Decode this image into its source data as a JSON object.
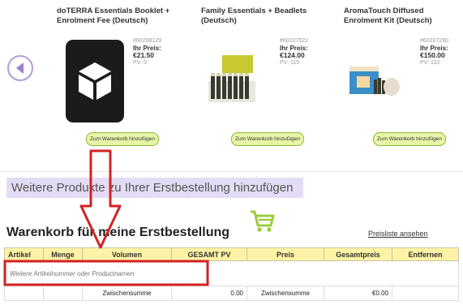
{
  "colors": {
    "accent_purple": "#9b7fd0",
    "banner_bg": "#e4dcf4",
    "table_header": "#fdf3a6",
    "add_button_bg": "#e6f5a8",
    "cart_green": "#9ccc3c",
    "annotation_red": "#d22222"
  },
  "carousel": {
    "prev_icon": "chevron-left-icon",
    "products": [
      {
        "name": "doTERRA Essentials Booklet + Enrolment Fee (Deutsch)",
        "sku": "#60208129",
        "price_label": "Ihr Preis:",
        "price": "€21.50",
        "pv": "PV: 0",
        "add_label": "Zum Warenkorb hinzufügen"
      },
      {
        "name": "Family Essentials + Beadlets (Deutsch)",
        "sku": "#60207522",
        "price_label": "Ihr Preis:",
        "price": "€124.00",
        "pv": "PV: 115",
        "add_label": "Zum Warenkorb hinzufügen"
      },
      {
        "name": "AromaTouch Diffused Enrolment Kit (Deutsch)",
        "sku": "#60207290",
        "price_label": "Ihr Preis:",
        "price": "€150.00",
        "pv": "PV: 110",
        "add_label": "Zum Warenkorb hinzufügen"
      }
    ]
  },
  "banner": {
    "text": "Weitere Produkte zu Ihrer Erstbestellung hinzufügen"
  },
  "cart": {
    "title": "Warenkorb für meine Erstbestellung",
    "icon": "shopping-cart-icon",
    "price_list_link": "Preisliste ansehen",
    "columns": [
      "Artikel",
      "Menge",
      "Volumen",
      "GESAMT PV",
      "Preis",
      "Gesamtpreis",
      "Entfernen"
    ],
    "search_placeholder": "Weitere Artikelnummer oder Productnamen",
    "subtotal_label_pv": "Zwischensumme",
    "subtotal_pv": "0.00",
    "subtotal_label_price": "Zwischensumme",
    "subtotal_price": "€0.00"
  }
}
